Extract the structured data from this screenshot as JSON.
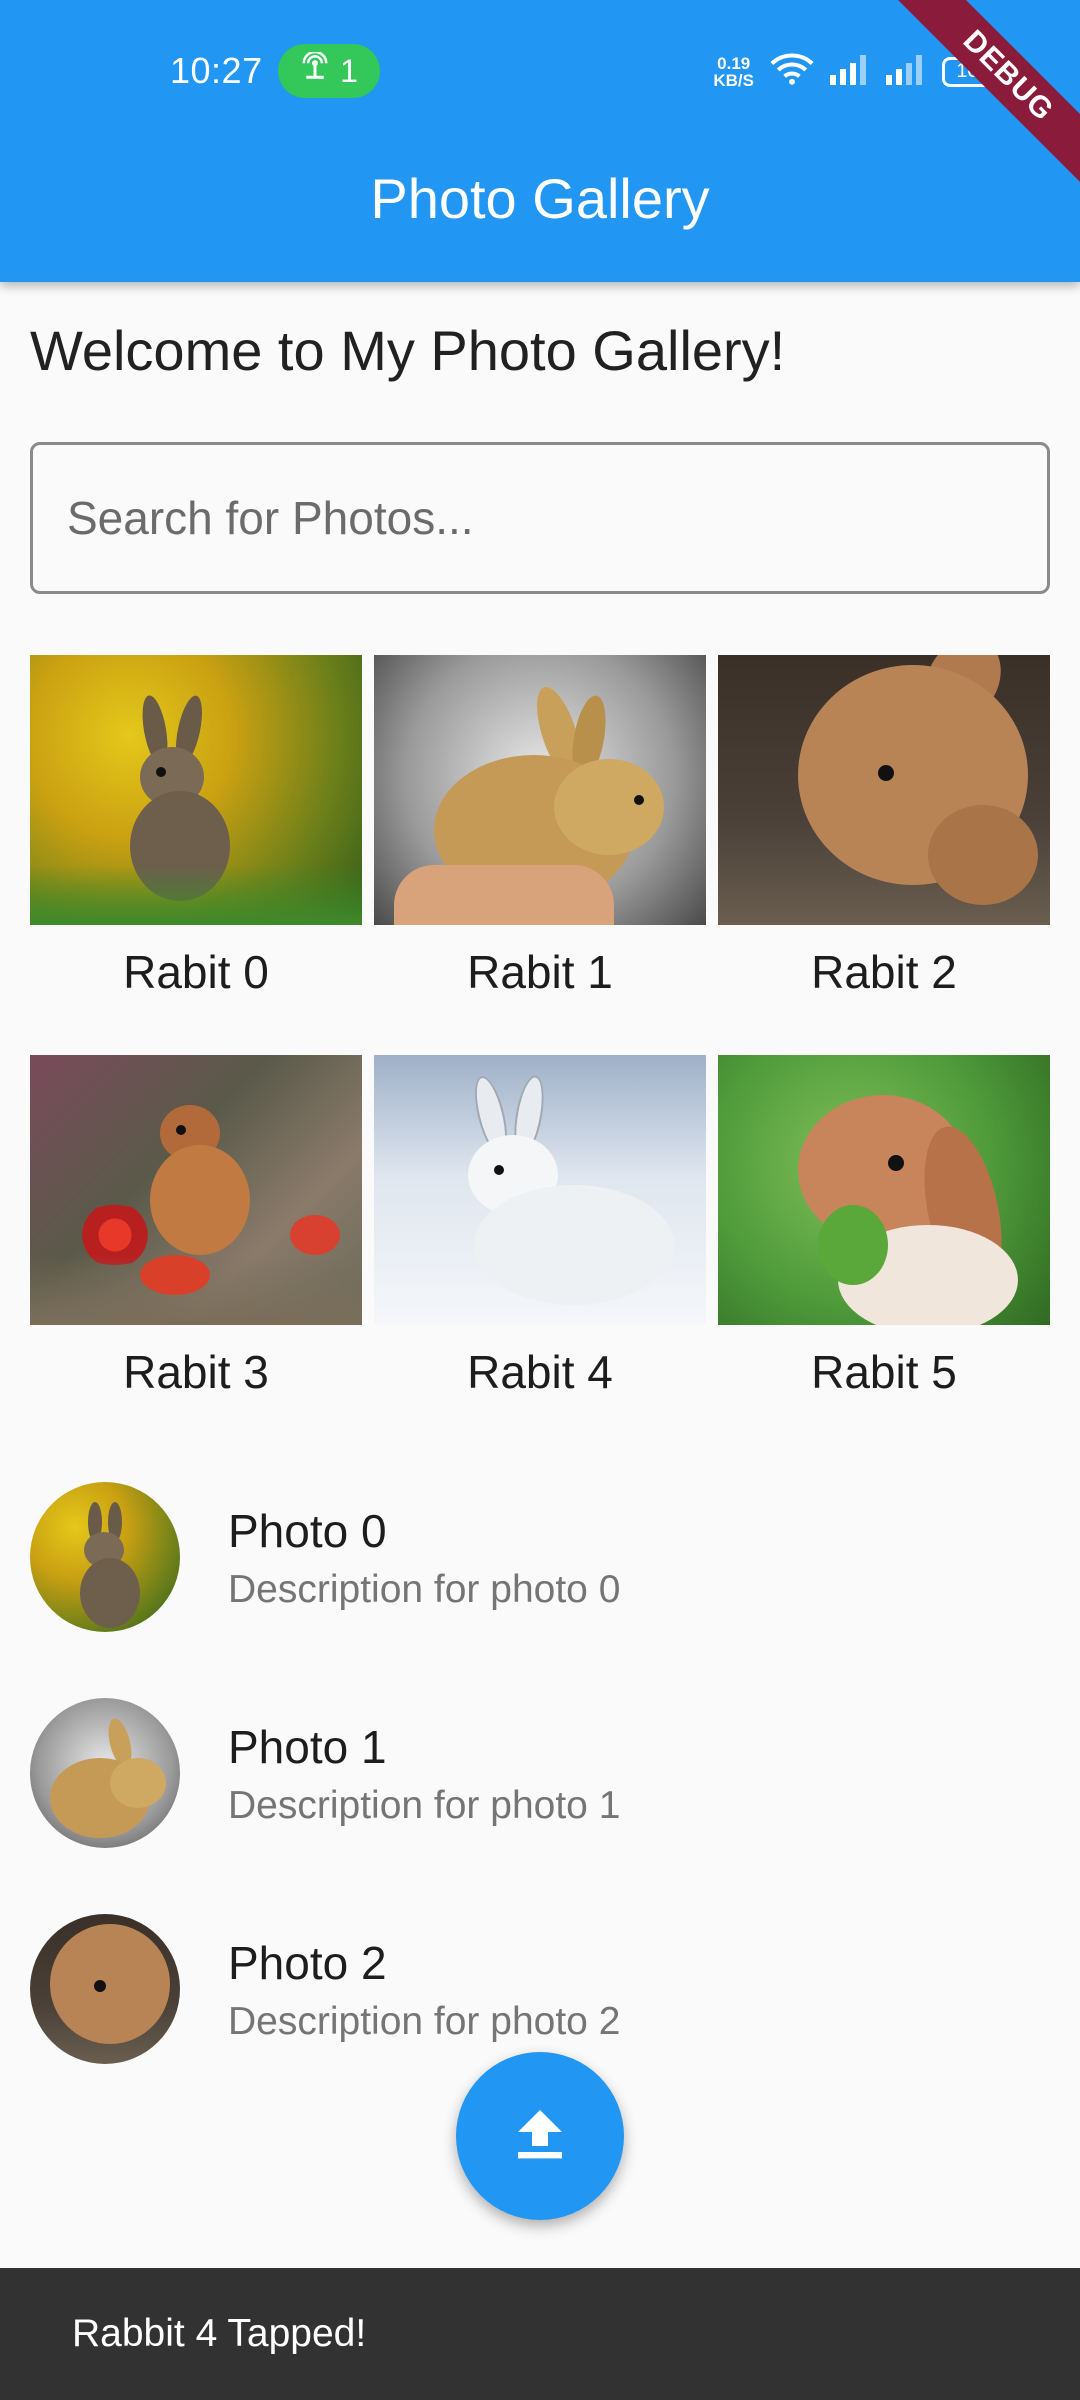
{
  "status_bar": {
    "time": "10:27",
    "hotspot_count": "1",
    "net_speed_value": "0.19",
    "net_speed_unit": "KB/S",
    "battery": "100"
  },
  "debug_banner": "DEBUG",
  "app_bar": {
    "title": "Photo Gallery"
  },
  "welcome": "Welcome to My Photo Gallery!",
  "search": {
    "placeholder": "Search for Photos...",
    "value": ""
  },
  "grid": {
    "items": [
      {
        "label": "Rabit 0"
      },
      {
        "label": "Rabit 1"
      },
      {
        "label": "Rabit 2"
      },
      {
        "label": "Rabit 3"
      },
      {
        "label": "Rabit 4"
      },
      {
        "label": "Rabit 5"
      }
    ]
  },
  "list": {
    "items": [
      {
        "title": "Photo 0",
        "subtitle": "Description for photo 0"
      },
      {
        "title": "Photo 1",
        "subtitle": "Description for photo 1"
      },
      {
        "title": "Photo 2",
        "subtitle": "Description for photo 2"
      }
    ]
  },
  "fab": {
    "icon": "upload-icon"
  },
  "snackbar": {
    "message": "Rabbit 4 Tapped!"
  },
  "colors": {
    "primary": "#2196f3",
    "hotspot": "#34c759",
    "debug_ribbon": "#8b1b3a",
    "snackbar": "#323232"
  }
}
